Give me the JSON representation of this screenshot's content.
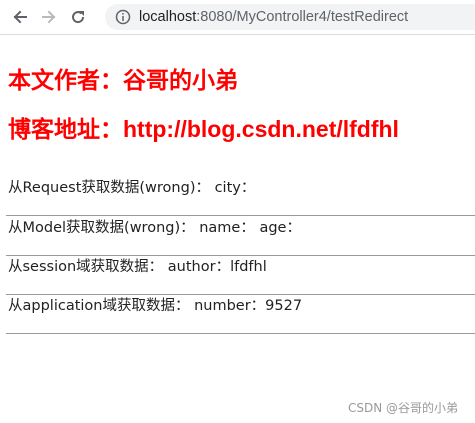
{
  "browser": {
    "url_host": "localhost",
    "url_path": ":8080/MyController4/testRedirect"
  },
  "page": {
    "author_heading": "本文作者：谷哥的小弟",
    "blog_heading": "博客地址：http://blog.csdn.net/lfdfhl",
    "rows": [
      "从Request获取数据(wrong)：  city：",
      "从Model获取数据(wrong)：  name：  age：",
      "从session域获取数据：  author：lfdfhl",
      "从application域获取数据：  number：9527"
    ]
  },
  "watermark": "CSDN @谷哥的小弟",
  "colors": {
    "heading": "#ff0000",
    "toolbar_icon": "#5f6368"
  }
}
